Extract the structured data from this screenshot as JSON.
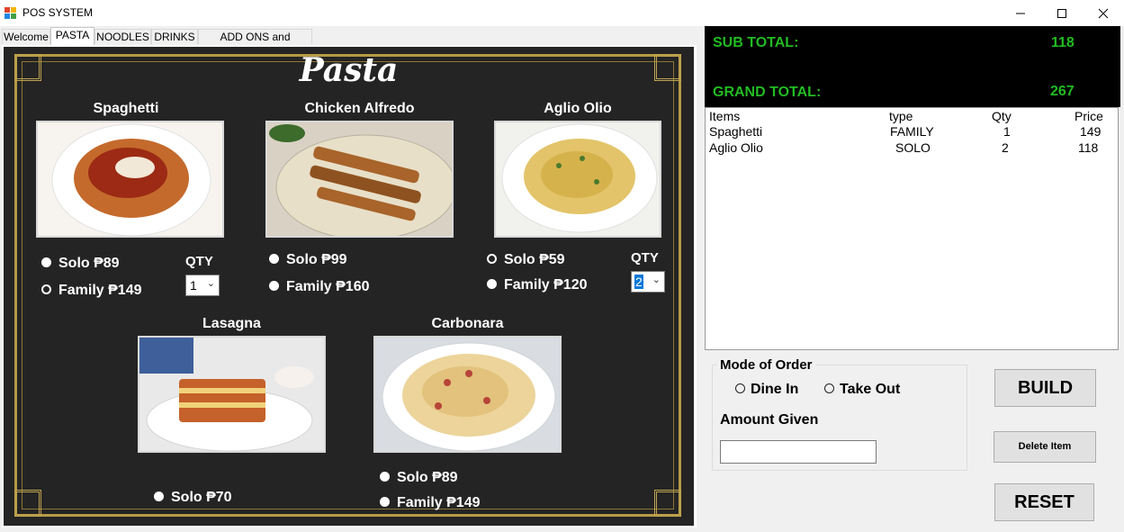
{
  "window": {
    "title": "POS SYSTEM",
    "controls": [
      "minimize",
      "maximize",
      "close"
    ]
  },
  "tabs": [
    {
      "label": "Welcome",
      "active": false
    },
    {
      "label": "PASTA",
      "active": true
    },
    {
      "label": "NOODLES",
      "active": false
    },
    {
      "label": "DRINKS",
      "active": false
    },
    {
      "label": "ADD ONS and SNACKS",
      "active": false
    }
  ],
  "menu": {
    "heading": "Pasta",
    "items": [
      {
        "name": "Spaghetti",
        "options": [
          {
            "label": "Solo ₱89",
            "checked": false
          },
          {
            "label": "Family ₱149",
            "checked": true
          }
        ],
        "qty_label": "QTY",
        "qty_value": "1"
      },
      {
        "name": "Chicken Alfredo",
        "options": [
          {
            "label": "Solo ₱99",
            "checked": false
          },
          {
            "label": "Family ₱160",
            "checked": false
          }
        ]
      },
      {
        "name": "Aglio Olio",
        "options": [
          {
            "label": "Solo ₱59",
            "checked": true
          },
          {
            "label": "Family ₱120",
            "checked": false
          }
        ],
        "qty_label": "QTY",
        "qty_value": "2"
      },
      {
        "name": "Lasagna",
        "options": [
          {
            "label": "Solo ₱70",
            "checked": false
          }
        ]
      },
      {
        "name": "Carbonara",
        "options": [
          {
            "label": "Solo ₱89",
            "checked": false
          },
          {
            "label": "Family ₱149",
            "checked": false
          }
        ]
      }
    ]
  },
  "totals": {
    "subtotal_label": "SUB TOTAL:",
    "subtotal_value": "118",
    "grand_label": "GRAND TOTAL:",
    "grand_value": "267",
    "text_color": "#22bb22"
  },
  "orders": {
    "columns": [
      "Items",
      "type",
      "Qty",
      "Price"
    ],
    "rows": [
      [
        "Spaghetti",
        "FAMILY",
        "1",
        "149"
      ],
      [
        "Aglio Olio",
        "SOLO",
        "2",
        "118"
      ]
    ]
  },
  "order_mode": {
    "title": "Mode of Order",
    "options": [
      {
        "label": "Dine In",
        "checked": false
      },
      {
        "label": "Take Out",
        "checked": false
      }
    ],
    "amount_label": "Amount Given",
    "amount_value": ""
  },
  "buttons": {
    "build": "BUILD",
    "delete": "Delete Item",
    "reset": "RESET"
  }
}
